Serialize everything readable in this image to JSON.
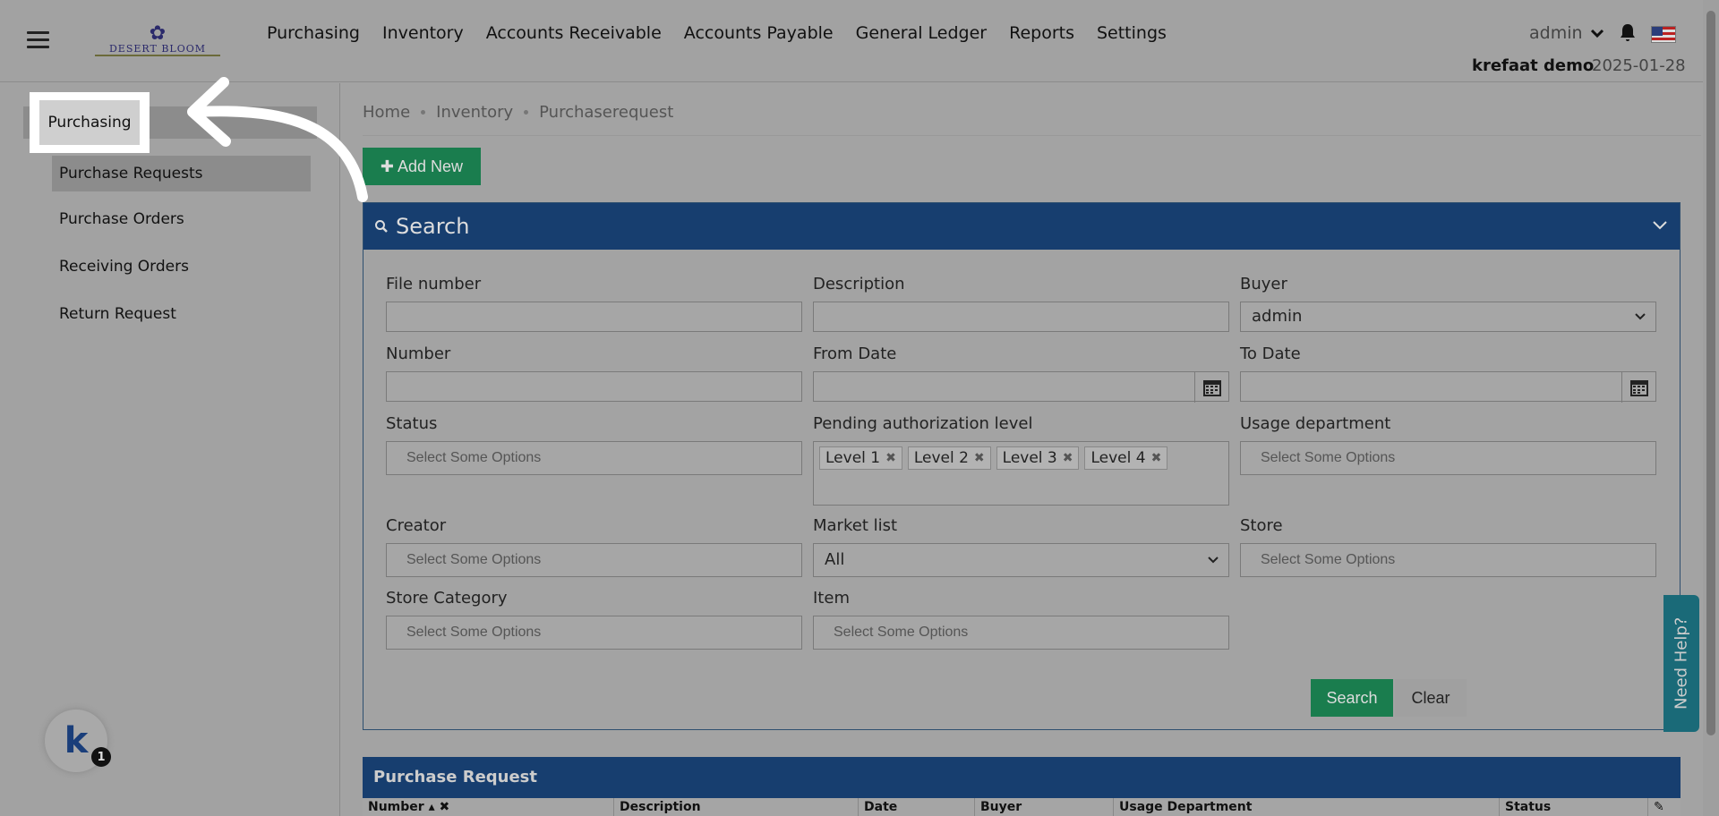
{
  "header": {
    "logo_text": "DESERT BLOOM",
    "nav": [
      "Purchasing",
      "Inventory",
      "Accounts Receivable",
      "Accounts Payable",
      "General Ledger",
      "Reports",
      "Settings"
    ],
    "user": "admin",
    "account": "krefaat demo",
    "date": "2025-01-28"
  },
  "sidebar": {
    "section": "Purchasing",
    "items": [
      "Purchase Requests",
      "Purchase Orders",
      "Receiving Orders",
      "Return Request"
    ]
  },
  "breadcrumb": [
    "Home",
    "Inventory",
    "Purchaserequest"
  ],
  "add_new_label": "Add New",
  "search_panel": {
    "title": "Search",
    "labels": {
      "file_number": "File number",
      "description": "Description",
      "buyer": "Buyer",
      "number": "Number",
      "from_date": "From Date",
      "to_date": "To Date",
      "status": "Status",
      "pending_level": "Pending authorization level",
      "usage_department": "Usage department",
      "creator": "Creator",
      "market_list": "Market list",
      "store": "Store",
      "store_category": "Store Category",
      "item": "Item"
    },
    "buyer_value": "admin",
    "market_list_value": "All",
    "placeholder": "Select Some Options",
    "level_tags": [
      "Level 1",
      "Level 2",
      "Level 3",
      "Level 4"
    ],
    "search_label": "Search",
    "clear_label": "Clear"
  },
  "help_label": "Need Help?",
  "table": {
    "title": "Purchase Request",
    "columns": [
      "Number",
      "Description",
      "Date",
      "Buyer",
      "Usage Department",
      "Status"
    ]
  },
  "badge_count": "1",
  "colors": {
    "header_blue": "#173e6f",
    "button_green": "#1a7d4e"
  }
}
